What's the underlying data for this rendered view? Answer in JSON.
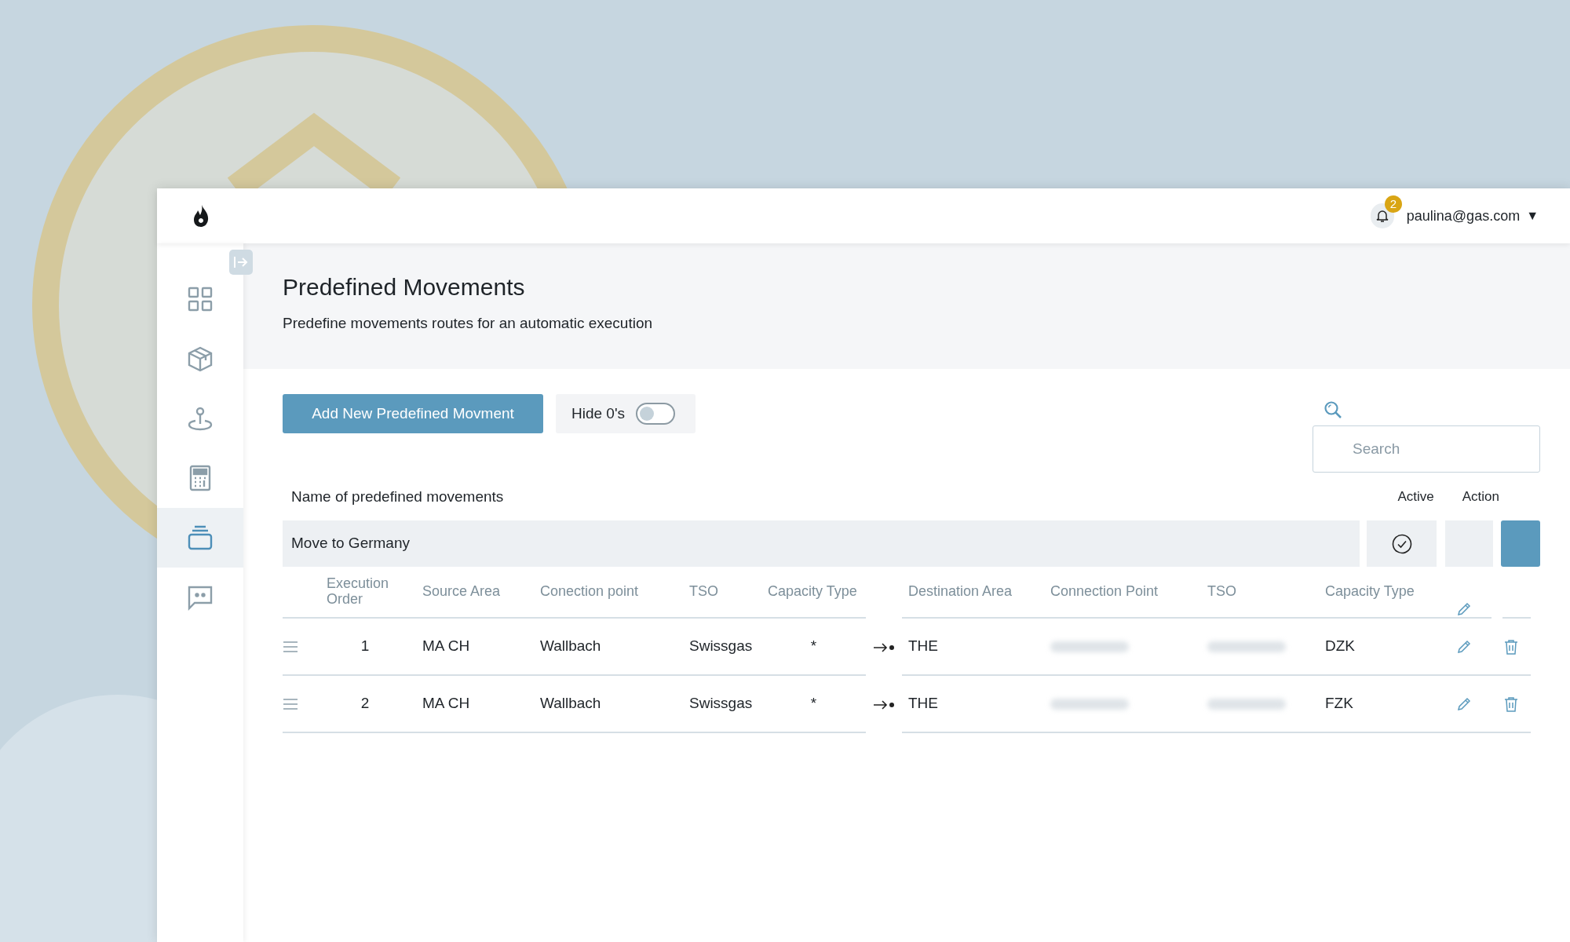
{
  "header": {
    "notifications": {
      "count": "2"
    },
    "user": {
      "email": "paulina@gas.com",
      "caret": "▼"
    }
  },
  "sidebar": {
    "items": [
      {
        "kind": "grid",
        "selected": false
      },
      {
        "kind": "box",
        "selected": false
      },
      {
        "kind": "pin",
        "selected": false
      },
      {
        "kind": "calculator",
        "selected": false
      },
      {
        "kind": "stack",
        "selected": true
      },
      {
        "kind": "chat",
        "selected": false
      }
    ]
  },
  "page": {
    "title": "Predefined Movements",
    "subtitle": "Predefine movements routes for an automatic execution"
  },
  "toolbar": {
    "add_button": "Add New Predefined Movment",
    "hide_zeros": {
      "label": "Hide 0's",
      "on": false
    },
    "search": {
      "placeholder": "Search"
    }
  },
  "table": {
    "name_header": "Name of predefined movements",
    "active_header": "Active",
    "action_header": "Action",
    "group": {
      "name": "Move to Germany",
      "active": true
    },
    "columns": [
      "Execution Order",
      "Source Area",
      "Conection point",
      "TSO",
      "Capacity Type",
      "Destination Area",
      "Connection Point",
      "TSO",
      "Capacity Type"
    ],
    "rows": [
      {
        "cells": [
          {
            "kind": "text",
            "text": "1"
          },
          {
            "kind": "text",
            "text": "MA CH"
          },
          {
            "kind": "text",
            "text": "Wallbach"
          },
          {
            "kind": "text",
            "text": "Swissgas"
          },
          {
            "kind": "text",
            "text": "*"
          },
          {
            "kind": "text",
            "text": "THE"
          },
          {
            "kind": "redacted"
          },
          {
            "kind": "redacted"
          },
          {
            "kind": "text",
            "text": "DZK"
          }
        ]
      },
      {
        "cells": [
          {
            "kind": "text",
            "text": "2"
          },
          {
            "kind": "text",
            "text": "MA CH"
          },
          {
            "kind": "text",
            "text": "Wallbach"
          },
          {
            "kind": "text",
            "text": "Swissgas"
          },
          {
            "kind": "text",
            "text": "*"
          },
          {
            "kind": "text",
            "text": "THE"
          },
          {
            "kind": "redacted"
          },
          {
            "kind": "redacted"
          },
          {
            "kind": "text",
            "text": "FZK"
          }
        ]
      }
    ]
  }
}
